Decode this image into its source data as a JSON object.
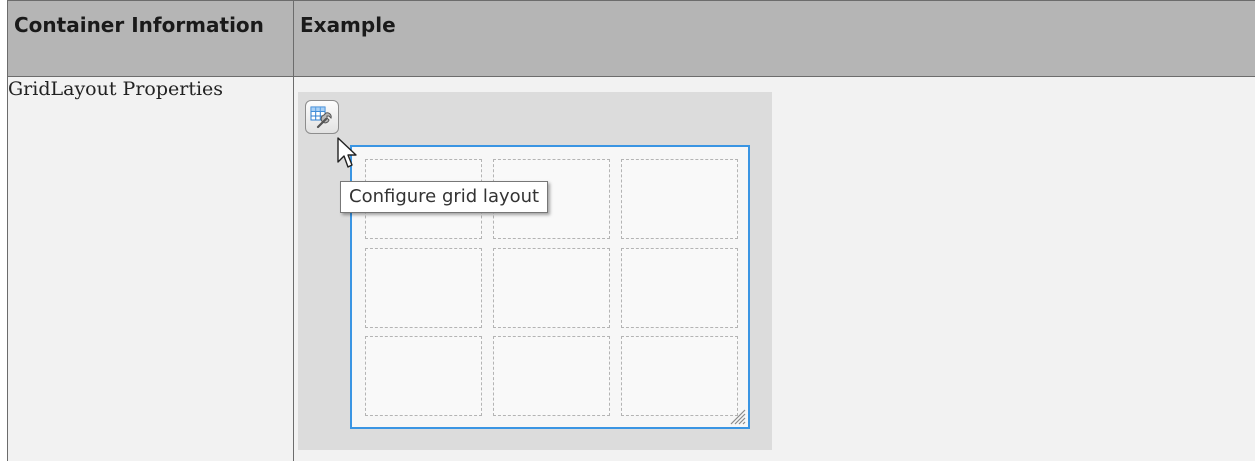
{
  "table": {
    "headers": {
      "col1": "Container Information",
      "col2": "Example"
    },
    "rows": [
      {
        "info": "GridLayout Properties"
      }
    ]
  },
  "example": {
    "tooltip_text": "Configure grid layout",
    "grid": {
      "rows": 3,
      "columns": 3
    },
    "colors": {
      "grid_border": "#3a95e3",
      "figure_background": "#dcdcdc"
    },
    "icons": [
      "grid-wrench-icon",
      "cursor-arrow-icon",
      "resize-handle-icon"
    ]
  }
}
